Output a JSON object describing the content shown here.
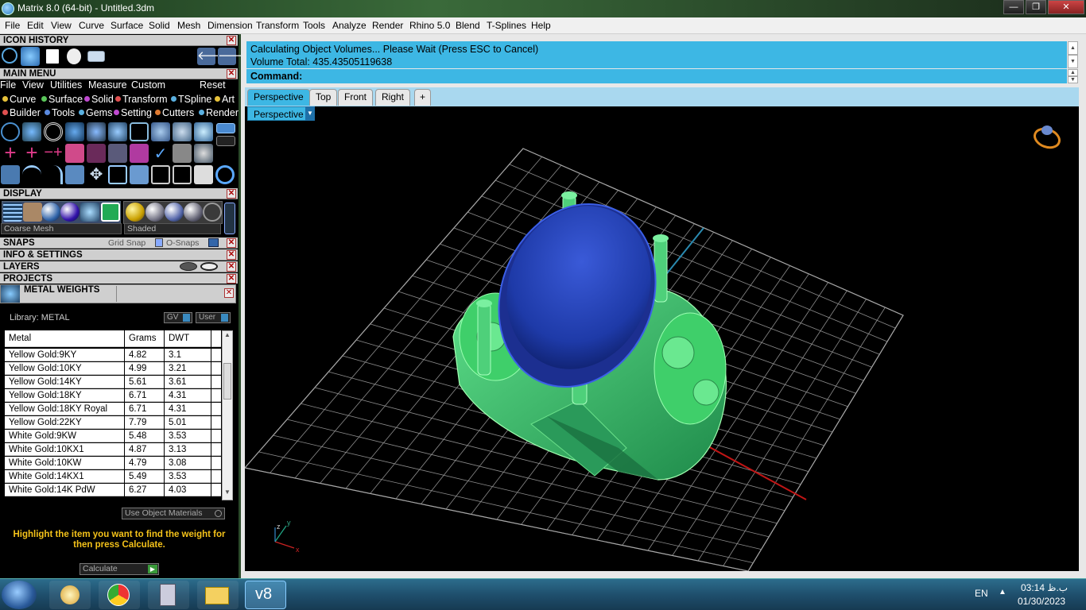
{
  "window": {
    "title": "Matrix 8.0 (64-bit) - Untitled.3dm",
    "min": "—",
    "max": "❐",
    "close": "✕"
  },
  "menu": [
    "File",
    "Edit",
    "View",
    "Curve",
    "Surface",
    "Solid",
    "Mesh",
    "Dimension",
    "Transform",
    "Tools",
    "Analyze",
    "Render",
    "Rhino 5.0",
    "Blend",
    "T-Splines",
    "Help"
  ],
  "panels": {
    "icon_history": "ICON HISTORY",
    "main_menu": "MAIN MENU",
    "main_menu_items": [
      "File",
      "View",
      "Utilities",
      "Measure",
      "Custom",
      "Reset"
    ],
    "builder_row1": [
      "Curve",
      "Surface",
      "Solid",
      "Transform",
      "TSpline",
      "Art"
    ],
    "builder_row2": [
      "Builder",
      "Tools",
      "Gems",
      "Setting",
      "Cutters",
      "Render"
    ],
    "display": "DISPLAY",
    "mesh_select": "Coarse Mesh",
    "shade_select": "Shaded",
    "snaps": "SNAPS",
    "grid_snap": "Grid Snap",
    "osnaps": "O-Snaps",
    "info": "INFO & SETTINGS",
    "layers": "LAYERS",
    "projects": "PROJECTS",
    "metal_weights": "METAL WEIGHTS"
  },
  "metal": {
    "library": "Library: METAL",
    "gv": "GV",
    "user": "User",
    "headers": [
      "Metal",
      "Grams",
      "DWT"
    ],
    "rows": [
      [
        "Yellow Gold:9KY",
        "4.82",
        "3.1"
      ],
      [
        "Yellow Gold:10KY",
        "4.99",
        "3.21"
      ],
      [
        "Yellow Gold:14KY",
        "5.61",
        "3.61"
      ],
      [
        "Yellow Gold:18KY",
        "6.71",
        "4.31"
      ],
      [
        "Yellow Gold:18KY Royal",
        "6.71",
        "4.31"
      ],
      [
        "Yellow Gold:22KY",
        "7.79",
        "5.01"
      ],
      [
        "White Gold:9KW",
        "5.48",
        "3.53"
      ],
      [
        "White Gold:10KX1",
        "4.87",
        "3.13"
      ],
      [
        "White Gold:10KW",
        "4.79",
        "3.08"
      ],
      [
        "White Gold:14KX1",
        "5.49",
        "3.53"
      ],
      [
        "White Gold:14K PdW",
        "6.27",
        "4.03"
      ]
    ],
    "use_object_materials": "Use Object Materials",
    "hint": "Highlight the item you want to find the weight for then press Calculate.",
    "calculate": "Calculate"
  },
  "command": {
    "line1": "Calculating Object Volumes... Please Wait (Press ESC to Cancel)",
    "line2": "Volume Total: 435.43505119638",
    "prompt": "Command:"
  },
  "tabs": [
    "Perspective",
    "Top",
    "Front",
    "Right",
    "+"
  ],
  "viewport_label": "Perspective",
  "taskbar": {
    "lang": "EN",
    "time": "03:14 ب.ظ",
    "date": "01/30/2023",
    "app": "v8"
  },
  "colors": {
    "accent": "#3db7e4",
    "ring_green": "#3fc46a",
    "stone_blue": "#1f3aa8"
  }
}
